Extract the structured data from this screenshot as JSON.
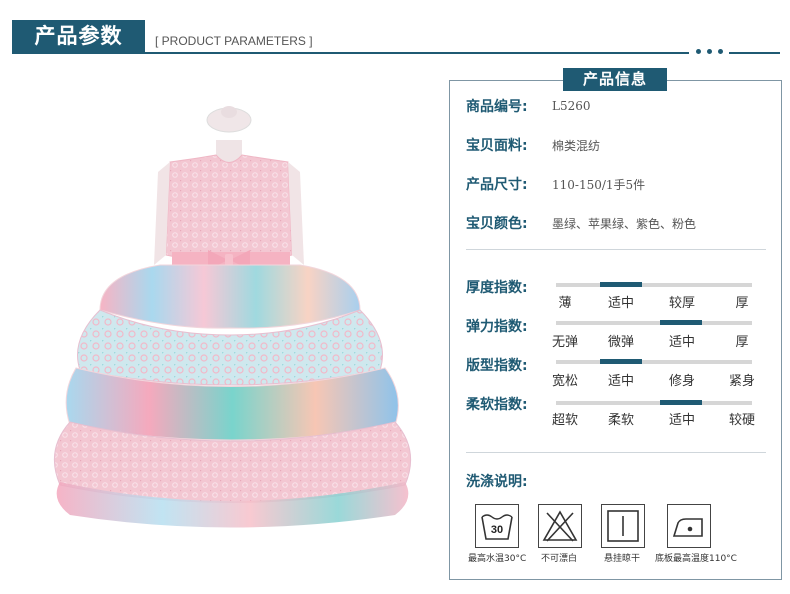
{
  "header": {
    "title": "产品参数",
    "subtitle": "[ PRODUCT PARAMETERS ]"
  },
  "panel": {
    "title": "产品信息",
    "info": [
      {
        "label": "商品编号:",
        "value": "L5260"
      },
      {
        "label": "宝贝面料:",
        "value": "棉类混纺"
      },
      {
        "label": "产品尺寸:",
        "value": "110-150/1手5件"
      },
      {
        "label": "宝贝颜色:",
        "value": "墨绿、苹果绿、紫色、粉色"
      }
    ],
    "indices": [
      {
        "label": "厚度指数:",
        "options": [
          "薄",
          "适中",
          "较厚",
          "厚"
        ],
        "selected": 1
      },
      {
        "label": "弹力指数:",
        "options": [
          "无弹",
          "微弹",
          "适中",
          "厚"
        ],
        "selected": 2
      },
      {
        "label": "版型指数:",
        "options": [
          "宽松",
          "适中",
          "修身",
          "紧身"
        ],
        "selected": 1
      },
      {
        "label": "柔软指数:",
        "options": [
          "超软",
          "柔软",
          "适中",
          "较硬"
        ],
        "selected": 2
      }
    ],
    "care": {
      "label": "洗涤说明:",
      "items": [
        {
          "icon": "wash-30-icon",
          "text": "最高水温30°C",
          "badge": "30"
        },
        {
          "icon": "no-bleach-icon",
          "text": "不可漂白"
        },
        {
          "icon": "hang-dry-icon",
          "text": "悬挂晾干"
        },
        {
          "icon": "iron-110-icon",
          "text": "底板最高温度110°C"
        }
      ]
    }
  },
  "colors": {
    "accent": "#1f5a73",
    "track": "#d6d6d6",
    "border": "#7f96a4"
  }
}
